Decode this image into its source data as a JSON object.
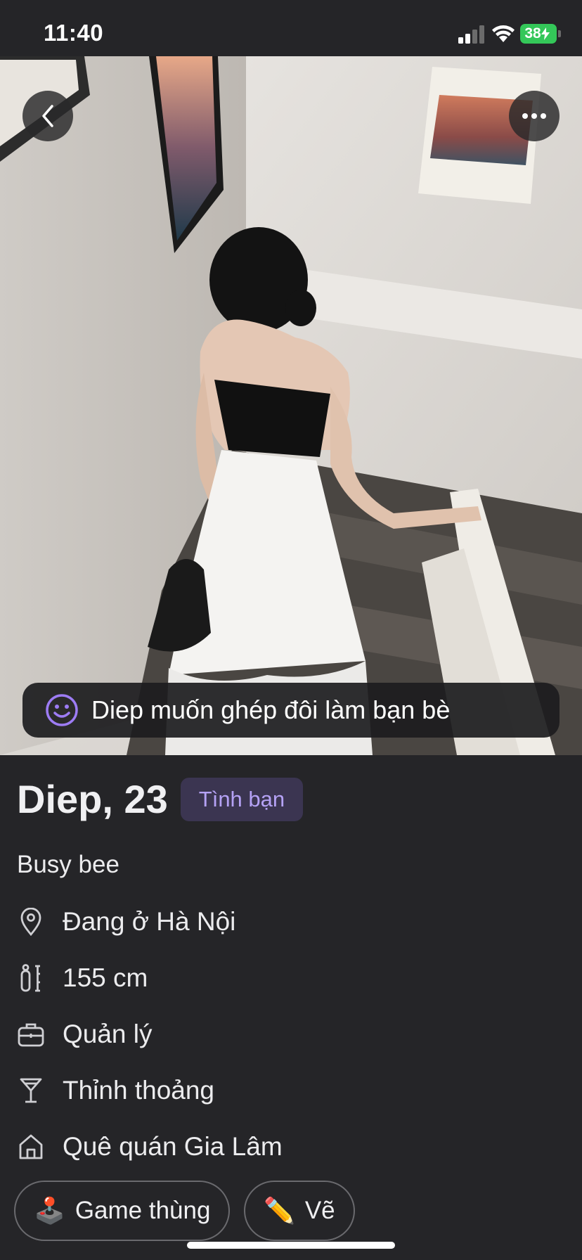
{
  "status_bar": {
    "time": "11:40",
    "battery": "38"
  },
  "profile": {
    "name_age": "Diep, 23",
    "tag": "Tình bạn",
    "bio": "Busy bee",
    "match_banner": "Diep muốn ghép đôi làm bạn bè",
    "info": [
      {
        "icon": "location-pin-icon",
        "text": "Đang ở Hà Nội"
      },
      {
        "icon": "height-icon",
        "text": "155 cm"
      },
      {
        "icon": "briefcase-icon",
        "text": "Quản lý"
      },
      {
        "icon": "cocktail-glass-icon",
        "text": "Thỉnh thoảng"
      },
      {
        "icon": "home-icon",
        "text": "Quê quán Gia Lâm"
      }
    ],
    "interests": [
      {
        "emoji": "🕹️",
        "label": "Game thùng"
      },
      {
        "emoji": "✏️",
        "label": "Vẽ"
      }
    ]
  },
  "colors": {
    "background": "#252528",
    "accent_purple": "#9D7CF4",
    "tag_bg": "#3B3551",
    "battery_green": "#34C759"
  }
}
